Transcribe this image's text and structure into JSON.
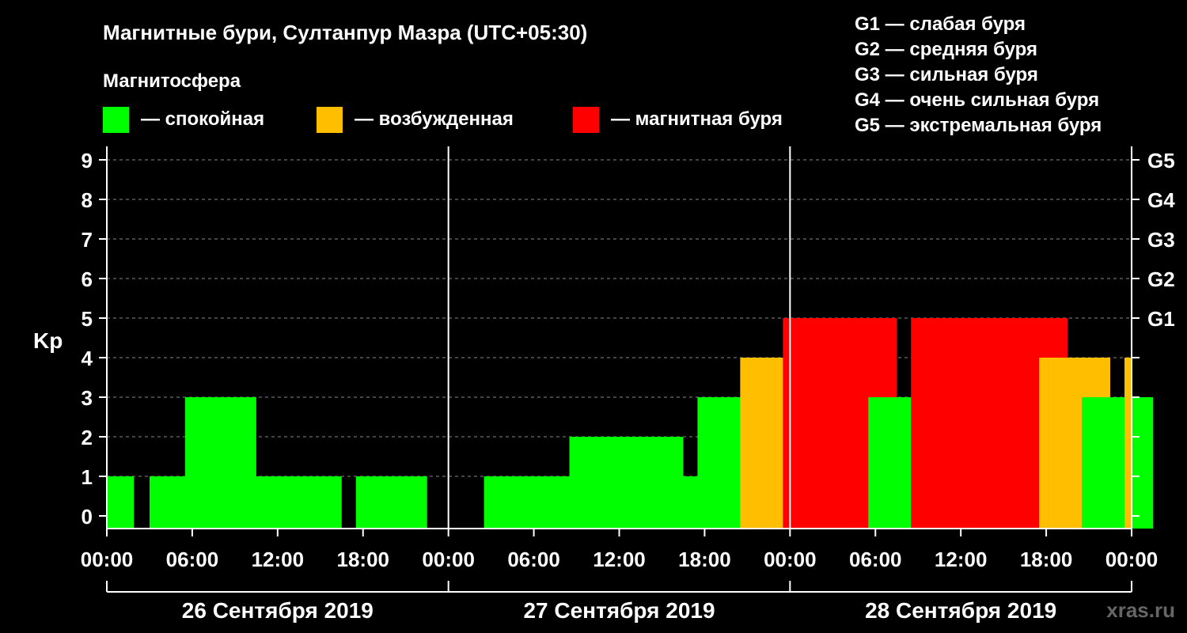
{
  "chart_data": {
    "type": "bar",
    "title": "Магнитные бури, Султанпур Мазра (UTC+05:30)",
    "legend_title": "Магнитосфера",
    "legend": [
      {
        "key": "quiet",
        "label": "— спокойная",
        "color": "#00ff00"
      },
      {
        "key": "active",
        "label": "— возбужденная",
        "color": "#ffbf00"
      },
      {
        "key": "storm",
        "label": "— магнитная буря",
        "color": "#ff0000"
      }
    ],
    "g_legend": [
      "G1 — слабая буря",
      "G2 — средняя буря",
      "G3 — сильная буря",
      "G4 — очень сильная буря",
      "G5 — экстремальная буря"
    ],
    "ylabel": "Kp",
    "ylim": [
      0,
      9
    ],
    "y_ticks": [
      "0",
      "1",
      "2",
      "3",
      "4",
      "5",
      "6",
      "7",
      "8",
      "9"
    ],
    "right_ticks": [
      {
        "value": 5,
        "label": "G1"
      },
      {
        "value": 6,
        "label": "G2"
      },
      {
        "value": 7,
        "label": "G3"
      },
      {
        "value": 8,
        "label": "G4"
      },
      {
        "value": 9,
        "label": "G5"
      }
    ],
    "x_tick_labels": [
      "00:00",
      "06:00",
      "12:00",
      "18:00",
      "00:00",
      "06:00",
      "12:00",
      "18:00",
      "00:00",
      "06:00",
      "12:00",
      "18:00",
      "00:00"
    ],
    "days": [
      "26 Сентября 2019",
      "27 Сентября 2019",
      "28 Сентября 2019"
    ],
    "bars": [
      {
        "start": 0,
        "end": 1.9,
        "kp": 1,
        "level": "quiet"
      },
      {
        "start": 3.0,
        "end": 7.5,
        "kp": 1,
        "level": "quiet"
      },
      {
        "start": 5.5,
        "end": 10.5,
        "kp": 3,
        "level": "quiet"
      },
      {
        "start": 8.5,
        "end": 13.5,
        "kp": 1,
        "level": "quiet"
      },
      {
        "start": 11.5,
        "end": 16.5,
        "kp": 1,
        "level": "quiet"
      },
      {
        "start": 17.5,
        "end": 22.5,
        "kp": 1,
        "level": "quiet"
      },
      {
        "start": 26.5,
        "end": 31.5,
        "kp": 1,
        "level": "quiet"
      },
      {
        "start": 29.5,
        "end": 34.5,
        "kp": 1,
        "level": "quiet"
      },
      {
        "start": 32.5,
        "end": 37.5,
        "kp": 2,
        "level": "quiet"
      },
      {
        "start": 35.5,
        "end": 40.5,
        "kp": 2,
        "level": "quiet"
      },
      {
        "start": 38.5,
        "end": 43.5,
        "kp": 1,
        "level": "quiet"
      },
      {
        "start": 41.5,
        "end": 46.5,
        "kp": 3,
        "level": "quiet"
      },
      {
        "start": 44.5,
        "end": 49.5,
        "kp": 4,
        "level": "active"
      },
      {
        "start": 47.5,
        "end": 52.5,
        "kp": 5,
        "level": "storm"
      },
      {
        "start": 50.5,
        "end": 55.5,
        "kp": 5,
        "level": "storm"
      },
      {
        "start": 53.5,
        "end": 58.5,
        "kp": 3,
        "level": "quiet"
      },
      {
        "start": 56.5,
        "end": 61.5,
        "kp": 5,
        "level": "storm"
      },
      {
        "start": 59.5,
        "end": 64.5,
        "kp": 5,
        "level": "storm"
      },
      {
        "start": 62.5,
        "end": 67.5,
        "kp": 5,
        "level": "storm"
      },
      {
        "start": 65.5,
        "end": 70.5,
        "kp": 4,
        "level": "active"
      },
      {
        "start": 68.5,
        "end": 73.5,
        "kp": 3,
        "level": "quiet"
      },
      {
        "start": 71.5,
        "end": 72,
        "kp": 4,
        "level": "active"
      }
    ],
    "watermark": "xras.ru"
  }
}
